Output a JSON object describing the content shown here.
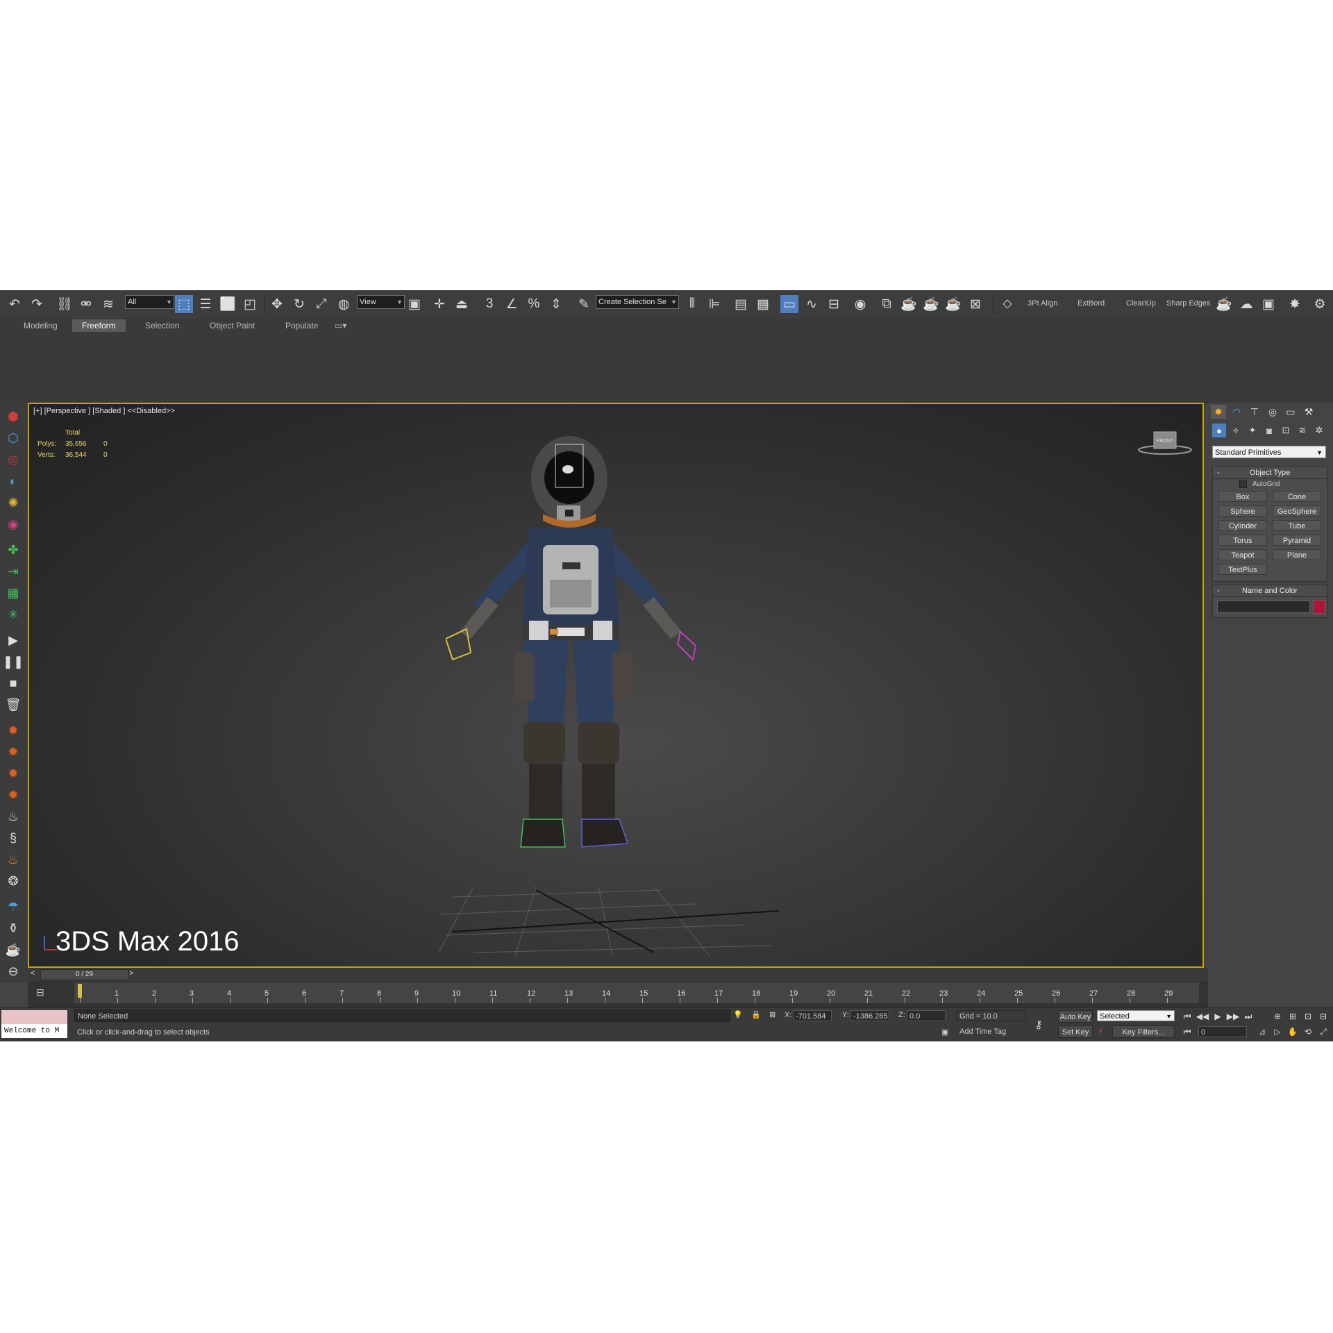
{
  "toolbar": {
    "selection_filter": "All",
    "ref_coord": "View",
    "named_selection": "Create Selection Se",
    "snap_labels": [
      "3",
      "%"
    ],
    "scripts": [
      "3Pt Align",
      "ExtBord",
      "CleanUp",
      "Sharp Edges"
    ]
  },
  "ribbon": {
    "tabs": [
      "Modeling",
      "Freeform",
      "Selection",
      "Object Paint",
      "Populate"
    ],
    "active_tab": "Freeform"
  },
  "viewport": {
    "label": "[+] [Perspective ] [Shaded ]  <<Disabled>>",
    "stats_header": "Total",
    "polys_label": "Polys:",
    "polys_value": "35,656",
    "polys_sel": "0",
    "verts_label": "Verts:",
    "verts_value": "36,544",
    "verts_sel": "0",
    "viewcube_label": "FRONT",
    "overlay_text": "3DS Max 2016"
  },
  "command_panel": {
    "category": "Standard Primitives",
    "object_type_title": "Object Type",
    "autogrid_label": "AutoGrid",
    "primitives": [
      "Box",
      "Cone",
      "Sphere",
      "GeoSphere",
      "Cylinder",
      "Tube",
      "Torus",
      "Pyramid",
      "Teapot",
      "Plane",
      "TextPlus"
    ],
    "name_color_title": "Name and Color",
    "object_color": "#b0123a"
  },
  "timeline": {
    "slider_label": "0 / 29",
    "frames": [
      "1",
      "2",
      "3",
      "4",
      "5",
      "6",
      "7",
      "8",
      "9",
      "10",
      "11",
      "12",
      "13",
      "14",
      "15",
      "16",
      "17",
      "18",
      "19",
      "20",
      "21",
      "22",
      "23",
      "24",
      "25",
      "26",
      "27",
      "28",
      "29"
    ]
  },
  "status_bar": {
    "script_text": "Welcome to M",
    "selection_status": "None Selected",
    "prompt": "Click or click-and-drag to select objects",
    "x_label": "X:",
    "x_value": "-701.584",
    "y_label": "Y:",
    "y_value": "-1386.285",
    "z_label": "Z:",
    "z_value": "0.0",
    "grid": "Grid = 10.0",
    "add_time_tag": "Add Time Tag",
    "auto_key": "Auto Key",
    "set_key": "Set Key",
    "key_mode": "Selected",
    "key_filters": "Key Filters...",
    "current_frame": "0"
  }
}
